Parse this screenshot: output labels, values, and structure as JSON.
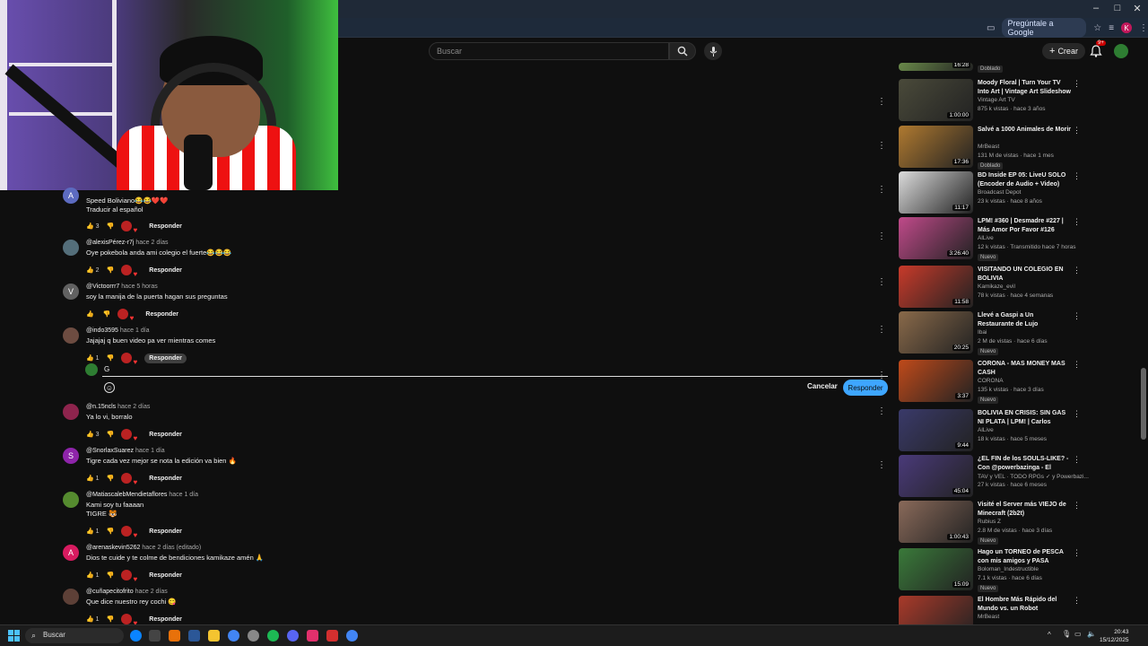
{
  "browser": {
    "ask_google": "Pregúntale a Google",
    "profile_initial": "K"
  },
  "youtube": {
    "search_placeholder": "Buscar",
    "create_label": "Crear",
    "notif_badge": "9+"
  },
  "comments": [
    {
      "avatar": "A",
      "avatar_color": "#5c6bc0",
      "author": "",
      "time": "",
      "text1": "Speed Boliviano😂😂❤️❤️",
      "text2": "Traducir al español",
      "likes": "3"
    },
    {
      "avatar": "",
      "avatar_color": "#546e7a",
      "author": "@alexisPérez-r7j",
      "time": "hace 2 días",
      "text1": "Oye pokebola anda ami colegio el fuerte😂😂😂",
      "text2": "",
      "likes": "2"
    },
    {
      "avatar": "V",
      "avatar_color": "#616161",
      "author": "@Victoorrr7",
      "time": "hace 5 horas",
      "text1": "soy la manija de la puerta hagan sus preguntas",
      "text2": "",
      "likes": ""
    },
    {
      "avatar": "",
      "avatar_color": "#6d4c41",
      "author": "@indo3595",
      "time": "hace 1 día",
      "text1": "Jajajaj q buen video pa ver mientras comes",
      "text2": "",
      "likes": "1"
    },
    {
      "avatar": "",
      "avatar_color": "#8e244d",
      "author": "@n.15ncls",
      "time": "hace 2 días",
      "text1": "Ya lo vi, borralo",
      "text2": "",
      "likes": "3"
    },
    {
      "avatar": "S",
      "avatar_color": "#8e24aa",
      "author": "@SnorlaxSuarez",
      "time": "hace 1 día",
      "text1": "Tigre cada vez mejor se nota la edición va bien 🔥",
      "text2": "",
      "likes": "1"
    },
    {
      "avatar": "",
      "avatar_color": "#558b2f",
      "author": "@MatiascalebMendietaflores",
      "time": "hace 1 día",
      "text1": "Kami soy tu faaaan",
      "text2": "TIGRE 🐯",
      "likes": "1"
    },
    {
      "avatar": "A",
      "avatar_color": "#d81b60",
      "author": "@arenaskevin5262",
      "time": "hace 2 días (editado)",
      "text1": "Dios te cuide y te colme de bendiciones kamikaze amén 🙏",
      "text2": "",
      "likes": "1"
    },
    {
      "avatar": "",
      "avatar_color": "#5d4037",
      "author": "@cuñapecitofrito",
      "time": "hace 2 días",
      "text1": "Que dice nuestro rey cochi 😋",
      "text2": "",
      "likes": "1"
    }
  ],
  "reply": {
    "label": "Responder",
    "input_value": "G",
    "cancel": "Cancelar",
    "submit": "Responder"
  },
  "recs": [
    {
      "title": "",
      "channel": "",
      "meta": "",
      "badge": "Doblado",
      "dur": "16:28",
      "thumb": "#6a8a4a"
    },
    {
      "title": "Moody Floral | Turn Your TV Into Art | Vintage Art Slideshow Fo...",
      "channel": "Vintage Art TV",
      "meta": "875 k vistas · hace 3 años",
      "badge": "",
      "dur": "1:00:00",
      "thumb": "#4a4a3a"
    },
    {
      "title": "Salvé a 1000 Animales de Morir",
      "channel": "MrBeast",
      "meta": "131 M de vistas · hace 1 mes",
      "badge": "Doblado",
      "dur": "17:36",
      "thumb": "#b07a30"
    },
    {
      "title": "BD Inside EP 05: LiveU SOLO (Encoder de Audio + Video)",
      "channel": "Broadcast Depot",
      "meta": "23 k vistas · hace 8 años",
      "badge": "",
      "dur": "11:17",
      "thumb": "#dcdcdc"
    },
    {
      "title": "LPM! #360 | Desmadre #227 | Más Amor Por Favor #126",
      "channel": "AlLive",
      "meta": "12 k vistas · Transmitido hace 7 horas",
      "badge": "Nuevo",
      "dur": "3:26:40",
      "thumb": "#c04a8a"
    },
    {
      "title": "VISITANDO UN COLEGIO EN BOLIVIA",
      "channel": "Kamikaze_evil",
      "meta": "78 k vistas · hace 4 semanas",
      "badge": "",
      "dur": "11:58",
      "thumb": "#c83a2a"
    },
    {
      "title": "Llevé a Gaspi a Un Restaurante de Lujo",
      "channel": "Ibai",
      "meta": "2 M de vistas · hace 6 días",
      "badge": "Nuevo",
      "dur": "20:25",
      "thumb": "#8a6a4a"
    },
    {
      "title": "CORONA - MAS MONEY MAS CASH",
      "channel": "CORONA",
      "meta": "135 k vistas · hace 3 días",
      "badge": "Nuevo",
      "dur": "3:37",
      "thumb": "#c04a1a"
    },
    {
      "title": "BOLIVIA EN CRISIS: SIN GAS NI PLATA | LPM! | Carlos Valverd...",
      "channel": "AlLive",
      "meta": "18 k vistas · hace 5 meses",
      "badge": "",
      "dur": "9:44",
      "thumb": "#3a3a6a"
    },
    {
      "title": "¿EL FIN de los SOULS-LIKE? - Con @powerbazinga - El TAV-...",
      "channel": "TAV y VEL · TODO RPGs ✓ y Powerbazi...",
      "meta": "27 k vistas · hace 6 meses",
      "badge": "",
      "dur": "45:04",
      "thumb": "#4a3a7a"
    },
    {
      "title": "Visité el Server más VIEJO de Minecraft (2b2t)",
      "channel": "Rubius Z",
      "meta": "2.8 M de vistas · hace 3 días",
      "badge": "Nuevo",
      "dur": "1:00:43",
      "thumb": "#8a6a5a"
    },
    {
      "title": "Hago un TORNEO de PESCA con mis amigos y PASA ESTO...",
      "channel": "Boloman_Indestructible",
      "meta": "7.1 k vistas · hace 6 días",
      "badge": "Nuevo",
      "dur": "15:09",
      "thumb": "#3a7a3a"
    },
    {
      "title": "El Hombre Más Rápido del Mundo vs. un Robot",
      "channel": "MrBeast",
      "meta": "",
      "badge": "",
      "dur": "",
      "thumb": "#aa3a2a"
    }
  ],
  "taskbar": {
    "search": "Buscar",
    "time": "20:43",
    "date": "15/12/2025"
  }
}
